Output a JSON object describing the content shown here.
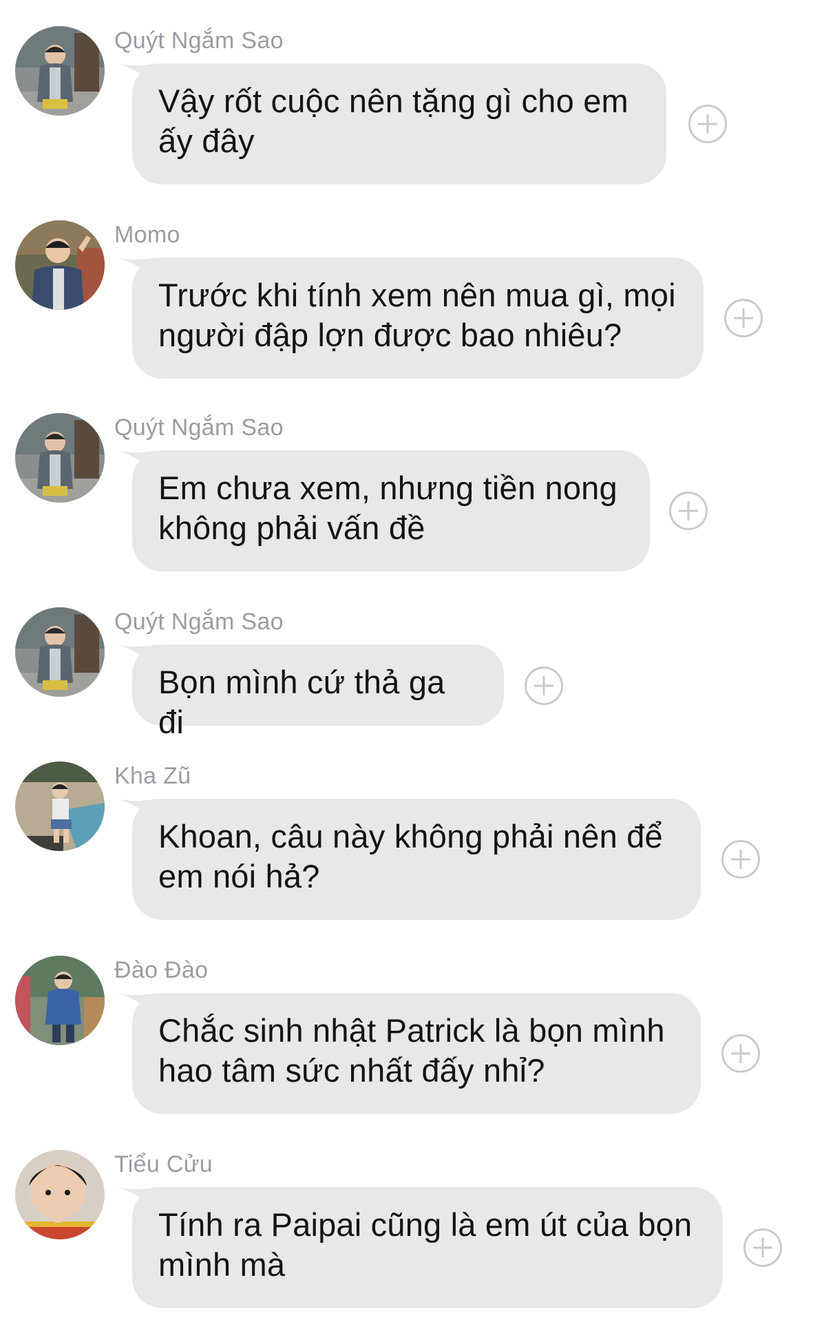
{
  "messages": [
    {
      "sender": "Quýt Ngắm Sao",
      "text": "Vậy rốt cuộc nên tặng gì cho em ấy đây",
      "avatar_icon": "child-grey-jacket-avatar"
    },
    {
      "sender": "Momo",
      "text": "Trước khi tính xem nên mua gì, mọi người đập lợn được bao nhiêu?",
      "avatar_icon": "child-peace-sign-avatar"
    },
    {
      "sender": "Quýt Ngắm Sao",
      "text": "Em chưa xem, nhưng tiền nong không phải vấn đề",
      "avatar_icon": "child-grey-jacket-avatar"
    },
    {
      "sender": "Quýt Ngắm Sao",
      "text": "Bọn mình cứ thả ga đi",
      "avatar_icon": "child-grey-jacket-avatar"
    },
    {
      "sender": "Kha Zũ",
      "text": "Khoan, câu này không phải nên để em nói hả?",
      "avatar_icon": "child-poolside-avatar"
    },
    {
      "sender": "Đào Đào",
      "text": "Chắc sinh nhật Patrick là bọn mình hao tâm sức nhất đấy nhỉ?",
      "avatar_icon": "child-blue-coat-avatar"
    },
    {
      "sender": "Tiểu Cửu",
      "text": "Tính ra Paipai cũng là em út của bọn mình mà",
      "avatar_icon": "child-closeup-avatar"
    }
  ],
  "colors": {
    "bubble": "#e8e8eb",
    "sender_text": "#9b9da3",
    "message_text": "#141414",
    "add_icon": "#c9cacd"
  },
  "icons": {
    "reaction": "plus-circle-icon"
  }
}
